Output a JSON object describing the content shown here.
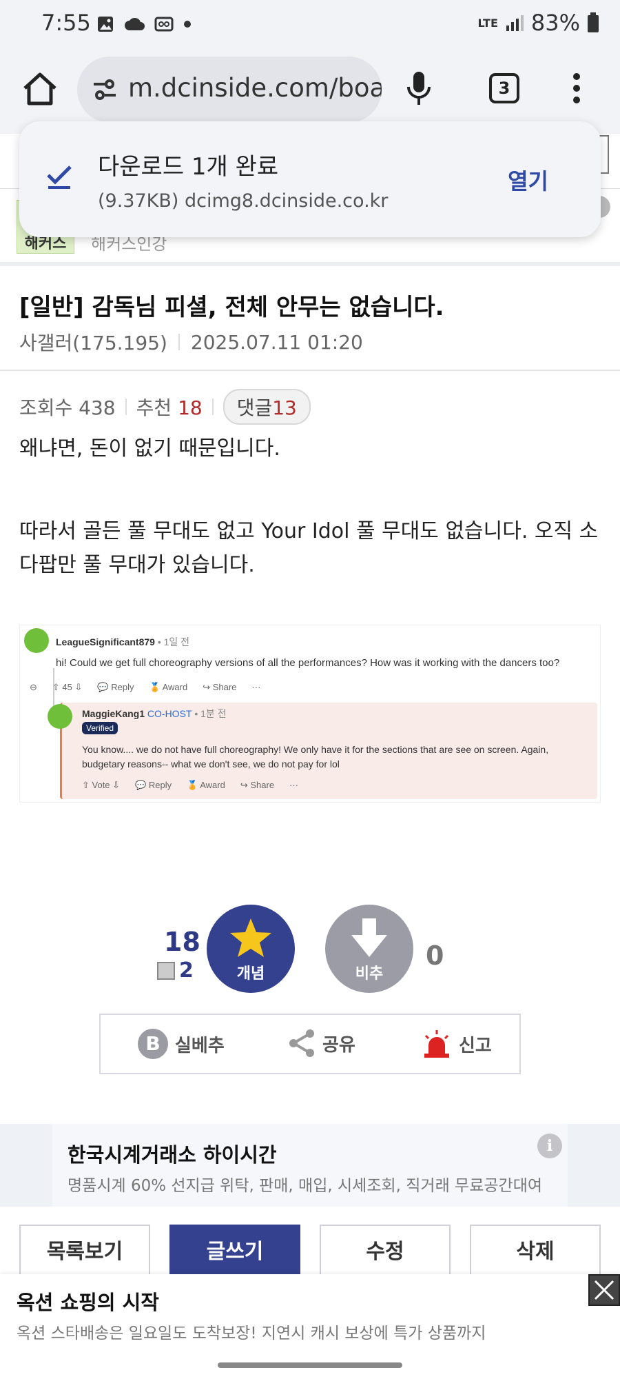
{
  "status_bar": {
    "time": "7:55",
    "battery": "83%",
    "network": "LTE"
  },
  "browser": {
    "url": "m.dcinside.com/board",
    "tab_count": "3"
  },
  "download_toast": {
    "title": "다운로드 1개 완료",
    "subtitle": "(9.37KB) dcimg8.dcinside.co.kr",
    "open_label": "열기"
  },
  "gallery": {
    "badge": "해커스",
    "name": "해커스인강"
  },
  "post": {
    "title": "[일반] 감독님 피셜, 전체 안무는 없습니다.",
    "author": "사갤러(175.195)",
    "datetime": "2025.07.11 01:20",
    "views_label": "조회수 438",
    "recommend_label": "추천",
    "recommend_count": "18",
    "comments_label": "댓글",
    "comments_count": "13",
    "body_line1": "왜냐면, 돈이 없기 때문입니다.",
    "body_line2": "따라서 골든 풀 무대도 없고 Your Idol 풀 무대도 없습니다. 오직 소다팝만 풀 무대가 있습니다."
  },
  "embed": {
    "comment1_user": "LeagueSignificant879",
    "comment1_time": "• 1일 전",
    "comment1_text": "hi! Could we get full choreography versions of all the performances? How was it working with the dancers too?",
    "comment1_votes": "45",
    "reply_label": "Reply",
    "award_label": "Award",
    "share_label": "Share",
    "more_label": "···",
    "comment2_user": "MaggieKang1",
    "comment2_role": "CO-HOST",
    "comment2_time": "• 1분 전",
    "verified_label": "Verified",
    "comment2_text": "You know.... we do not have full choreography! We only have it for the sections that are see on screen. Again, budgetary reasons-- what we don't see, we do not pay for lol",
    "vote_label": "Vote"
  },
  "voting": {
    "up_count": "18",
    "fix_count": "2",
    "up_label": "개념",
    "down_label": "비추",
    "down_count": "0"
  },
  "actions": {
    "silbe": "실베추",
    "share": "공유",
    "report": "신고"
  },
  "ad": {
    "title": "한국시계거래소 하이시간",
    "subtitle": "명품시계 60% 선지급 위탁, 판매, 매입, 시세조회, 직거래 무료공간대여"
  },
  "buttons": {
    "list": "목록보기",
    "write": "글쓰기",
    "edit": "수정",
    "delete": "삭제"
  },
  "bottom_ad": {
    "title": "옥션 쇼핑의 시작",
    "subtitle": "옥션 스타배송은 일요일도 도착보장! 지연시 캐시 보상에 특가 상품까지"
  },
  "colors": {
    "accent": "#34418f",
    "red": "#b22a2a",
    "downvote": "#9c9ca6"
  }
}
